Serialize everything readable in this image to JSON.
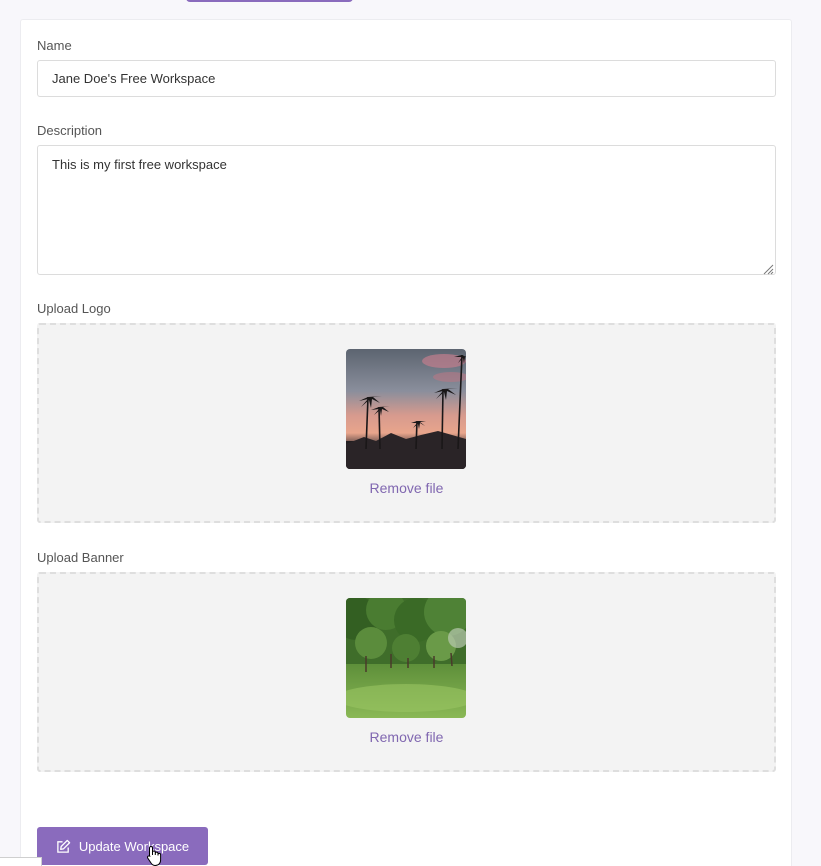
{
  "form": {
    "name": {
      "label": "Name",
      "value": "Jane Doe's Free Workspace"
    },
    "description": {
      "label": "Description",
      "value": "This is my first free workspace"
    },
    "logo": {
      "label": "Upload Logo",
      "remove_label": "Remove file",
      "image_icon": "sunset-palm-trees-photo"
    },
    "banner": {
      "label": "Upload Banner",
      "remove_label": "Remove file",
      "image_icon": "green-park-trees-photo"
    },
    "submit": {
      "label": "Update Workspace",
      "icon": "edit-icon"
    }
  },
  "colors": {
    "accent": "#8a6bbd",
    "link": "#8067b0",
    "dropzone_bg": "#f3f3f3",
    "page_bg": "#f8f7fb"
  }
}
